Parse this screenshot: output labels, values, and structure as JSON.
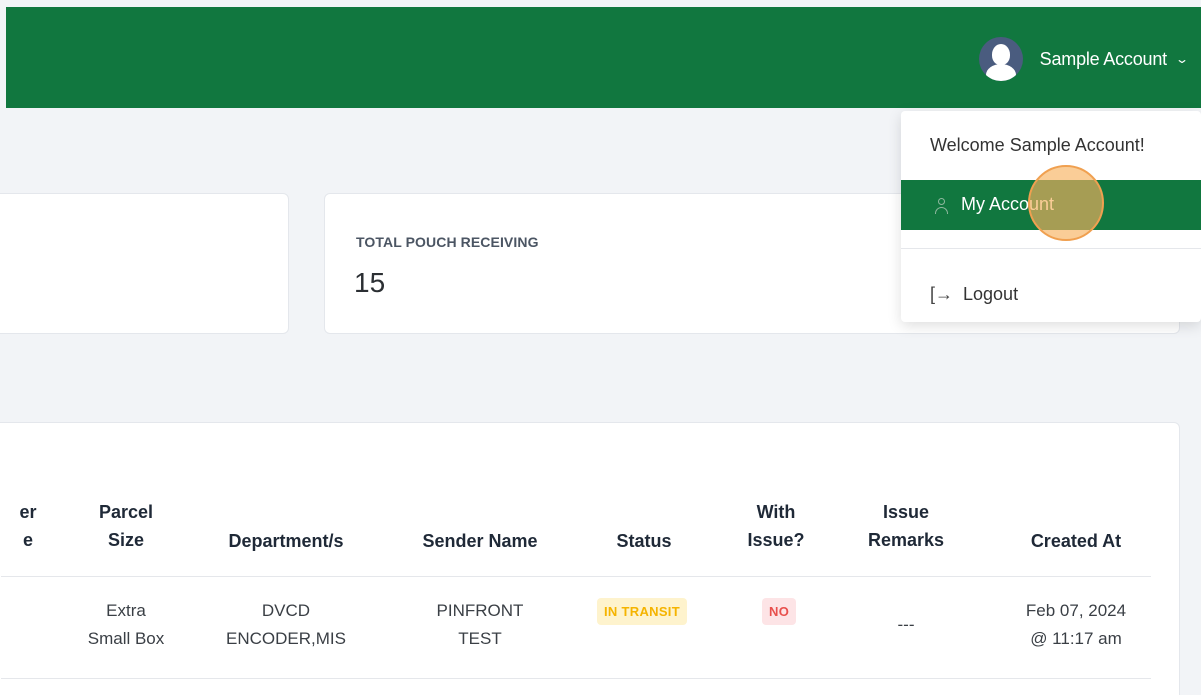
{
  "header": {
    "user_name": "Sample Account",
    "chevron": "⌄",
    "bar_color": "#11773f"
  },
  "dropdown": {
    "welcome": "Welcome Sample Account!",
    "my_account": "My Account",
    "logout": "Logout",
    "logout_icon": "[→"
  },
  "stats": {
    "pouch_label": "TOTAL POUCH RECEIVING",
    "pouch_value": "15"
  },
  "table": {
    "headers": {
      "cut_col": "er",
      "cut_col_line2": "e",
      "parcel_size_1": "Parcel",
      "parcel_size_2": "Size",
      "departments": "Department/s",
      "sender_name": "Sender Name",
      "status": "Status",
      "with_issue_1": "With",
      "with_issue_2": "Issue?",
      "issue_remarks_1": "Issue",
      "issue_remarks_2": "Remarks",
      "created_at": "Created At"
    },
    "rows": [
      {
        "parcel_size_1": "Extra",
        "parcel_size_2": "Small Box",
        "department_1": "DVCD",
        "department_2": "ENCODER,MIS",
        "sender_1": "PINFRONT",
        "sender_2": "TEST",
        "status": "IN TRANSIT",
        "with_issue": "NO",
        "remarks": "---",
        "created_1": "Feb 07, 2024",
        "created_2": "@ 11:17 am"
      }
    ]
  },
  "icons": [
    "avatar-icon",
    "chevron-down-icon",
    "person-icon",
    "logout-icon"
  ]
}
